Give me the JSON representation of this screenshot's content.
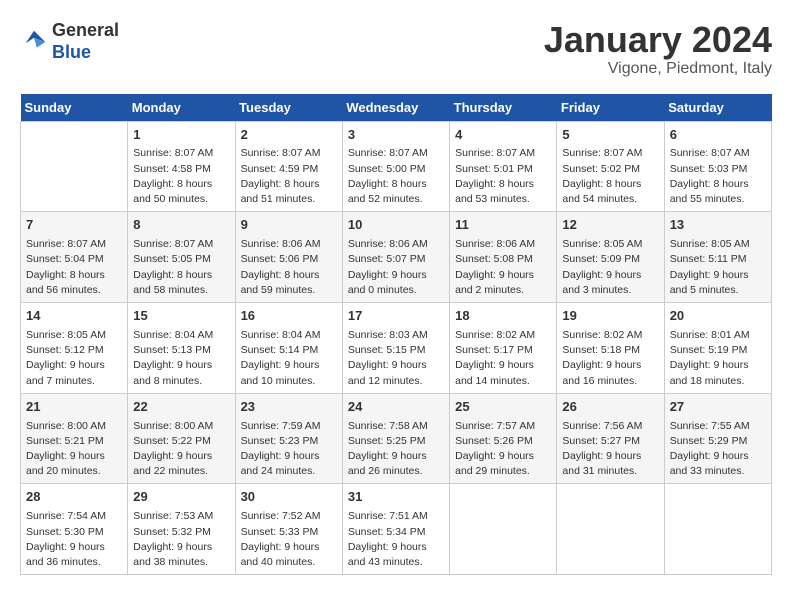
{
  "header": {
    "logo": {
      "general": "General",
      "blue": "Blue"
    },
    "title": "January 2024",
    "location": "Vigone, Piedmont, Italy"
  },
  "weekdays": [
    "Sunday",
    "Monday",
    "Tuesday",
    "Wednesday",
    "Thursday",
    "Friday",
    "Saturday"
  ],
  "weeks": [
    [
      {
        "day": "",
        "info": ""
      },
      {
        "day": "1",
        "info": "Sunrise: 8:07 AM\nSunset: 4:58 PM\nDaylight: 8 hours\nand 50 minutes."
      },
      {
        "day": "2",
        "info": "Sunrise: 8:07 AM\nSunset: 4:59 PM\nDaylight: 8 hours\nand 51 minutes."
      },
      {
        "day": "3",
        "info": "Sunrise: 8:07 AM\nSunset: 5:00 PM\nDaylight: 8 hours\nand 52 minutes."
      },
      {
        "day": "4",
        "info": "Sunrise: 8:07 AM\nSunset: 5:01 PM\nDaylight: 8 hours\nand 53 minutes."
      },
      {
        "day": "5",
        "info": "Sunrise: 8:07 AM\nSunset: 5:02 PM\nDaylight: 8 hours\nand 54 minutes."
      },
      {
        "day": "6",
        "info": "Sunrise: 8:07 AM\nSunset: 5:03 PM\nDaylight: 8 hours\nand 55 minutes."
      }
    ],
    [
      {
        "day": "7",
        "info": "Sunrise: 8:07 AM\nSunset: 5:04 PM\nDaylight: 8 hours\nand 56 minutes."
      },
      {
        "day": "8",
        "info": "Sunrise: 8:07 AM\nSunset: 5:05 PM\nDaylight: 8 hours\nand 58 minutes."
      },
      {
        "day": "9",
        "info": "Sunrise: 8:06 AM\nSunset: 5:06 PM\nDaylight: 8 hours\nand 59 minutes."
      },
      {
        "day": "10",
        "info": "Sunrise: 8:06 AM\nSunset: 5:07 PM\nDaylight: 9 hours\nand 0 minutes."
      },
      {
        "day": "11",
        "info": "Sunrise: 8:06 AM\nSunset: 5:08 PM\nDaylight: 9 hours\nand 2 minutes."
      },
      {
        "day": "12",
        "info": "Sunrise: 8:05 AM\nSunset: 5:09 PM\nDaylight: 9 hours\nand 3 minutes."
      },
      {
        "day": "13",
        "info": "Sunrise: 8:05 AM\nSunset: 5:11 PM\nDaylight: 9 hours\nand 5 minutes."
      }
    ],
    [
      {
        "day": "14",
        "info": "Sunrise: 8:05 AM\nSunset: 5:12 PM\nDaylight: 9 hours\nand 7 minutes."
      },
      {
        "day": "15",
        "info": "Sunrise: 8:04 AM\nSunset: 5:13 PM\nDaylight: 9 hours\nand 8 minutes."
      },
      {
        "day": "16",
        "info": "Sunrise: 8:04 AM\nSunset: 5:14 PM\nDaylight: 9 hours\nand 10 minutes."
      },
      {
        "day": "17",
        "info": "Sunrise: 8:03 AM\nSunset: 5:15 PM\nDaylight: 9 hours\nand 12 minutes."
      },
      {
        "day": "18",
        "info": "Sunrise: 8:02 AM\nSunset: 5:17 PM\nDaylight: 9 hours\nand 14 minutes."
      },
      {
        "day": "19",
        "info": "Sunrise: 8:02 AM\nSunset: 5:18 PM\nDaylight: 9 hours\nand 16 minutes."
      },
      {
        "day": "20",
        "info": "Sunrise: 8:01 AM\nSunset: 5:19 PM\nDaylight: 9 hours\nand 18 minutes."
      }
    ],
    [
      {
        "day": "21",
        "info": "Sunrise: 8:00 AM\nSunset: 5:21 PM\nDaylight: 9 hours\nand 20 minutes."
      },
      {
        "day": "22",
        "info": "Sunrise: 8:00 AM\nSunset: 5:22 PM\nDaylight: 9 hours\nand 22 minutes."
      },
      {
        "day": "23",
        "info": "Sunrise: 7:59 AM\nSunset: 5:23 PM\nDaylight: 9 hours\nand 24 minutes."
      },
      {
        "day": "24",
        "info": "Sunrise: 7:58 AM\nSunset: 5:25 PM\nDaylight: 9 hours\nand 26 minutes."
      },
      {
        "day": "25",
        "info": "Sunrise: 7:57 AM\nSunset: 5:26 PM\nDaylight: 9 hours\nand 29 minutes."
      },
      {
        "day": "26",
        "info": "Sunrise: 7:56 AM\nSunset: 5:27 PM\nDaylight: 9 hours\nand 31 minutes."
      },
      {
        "day": "27",
        "info": "Sunrise: 7:55 AM\nSunset: 5:29 PM\nDaylight: 9 hours\nand 33 minutes."
      }
    ],
    [
      {
        "day": "28",
        "info": "Sunrise: 7:54 AM\nSunset: 5:30 PM\nDaylight: 9 hours\nand 36 minutes."
      },
      {
        "day": "29",
        "info": "Sunrise: 7:53 AM\nSunset: 5:32 PM\nDaylight: 9 hours\nand 38 minutes."
      },
      {
        "day": "30",
        "info": "Sunrise: 7:52 AM\nSunset: 5:33 PM\nDaylight: 9 hours\nand 40 minutes."
      },
      {
        "day": "31",
        "info": "Sunrise: 7:51 AM\nSunset: 5:34 PM\nDaylight: 9 hours\nand 43 minutes."
      },
      {
        "day": "",
        "info": ""
      },
      {
        "day": "",
        "info": ""
      },
      {
        "day": "",
        "info": ""
      }
    ]
  ]
}
